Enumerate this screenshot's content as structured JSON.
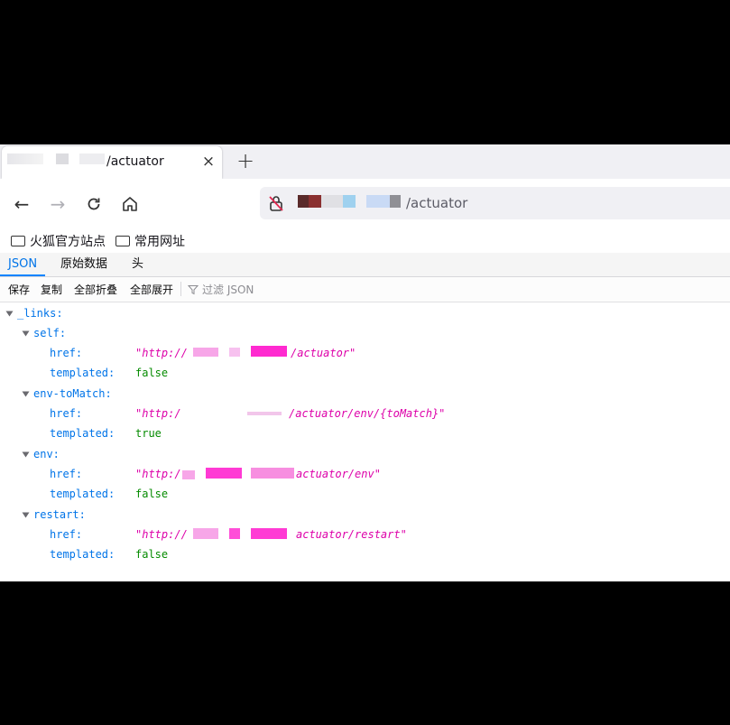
{
  "colors": {
    "key": "#0074e8",
    "string": "#dd00a9",
    "boolean": "#058b00",
    "active_tab": "#0a84ff",
    "redaction": "#ff4ed8"
  },
  "tab": {
    "title": "/actuator",
    "close_icon": "×"
  },
  "new_tab_icon": "+",
  "nav": {
    "back": "←",
    "forward": "→",
    "reload": "C",
    "home": "⌂"
  },
  "urlbar": {
    "text": "/actuator",
    "lock_icon": "insecure-lock-icon"
  },
  "bookmarks": [
    {
      "label": "火狐官方站点",
      "icon": "folder-icon"
    },
    {
      "label": "常用网址",
      "icon": "folder-icon"
    }
  ],
  "viewer_tabs": [
    {
      "label": "JSON",
      "active": true
    },
    {
      "label": "原始数据",
      "active": false
    },
    {
      "label": "头",
      "active": false
    }
  ],
  "toolbar": {
    "save": "保存",
    "copy": "复制",
    "collapse_all": "全部折叠",
    "expand_all": "全部展开",
    "filter_placeholder": "过滤 JSON"
  },
  "tree": {
    "root_key": "_links:",
    "entries": [
      {
        "name": "self:",
        "href_key": "href:",
        "href_prefix": "\"http://",
        "href_suffix": "/actuator\"",
        "templated_key": "templated:",
        "templated": "false"
      },
      {
        "name": "env-toMatch:",
        "href_key": "href:",
        "href_prefix": "\"http:/",
        "href_suffix": "/actuator/env/{toMatch}\"",
        "templated_key": "templated:",
        "templated": "true"
      },
      {
        "name": "env:",
        "href_key": "href:",
        "href_prefix": "\"http:/",
        "href_suffix": "actuator/env\"",
        "templated_key": "templated:",
        "templated": "false"
      },
      {
        "name": "restart:",
        "href_key": "href:",
        "href_prefix": "\"http://",
        "href_suffix": "actuator/restart\"",
        "templated_key": "templated:",
        "templated": "false"
      }
    ]
  }
}
